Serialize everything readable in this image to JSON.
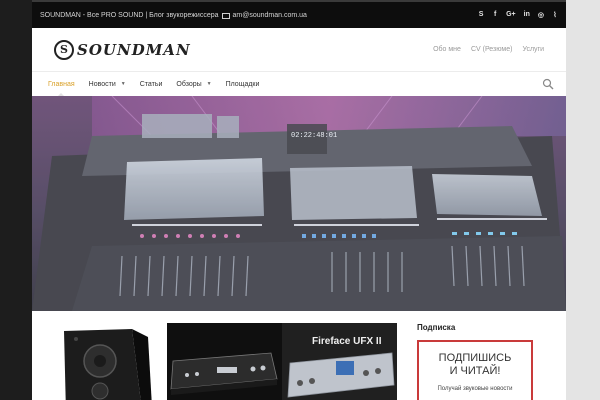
{
  "topbar": {
    "tagline": "SOUNDMAN - Все PRO SOUND | Блог звукорежиссера",
    "email": "am@soundman.com.ua",
    "social_icons": [
      {
        "name": "skype-icon",
        "glyph": "S"
      },
      {
        "name": "facebook-icon",
        "glyph": "f"
      },
      {
        "name": "google-plus-icon",
        "glyph": "G+"
      },
      {
        "name": "linkedin-icon",
        "glyph": "in"
      },
      {
        "name": "instagram-icon",
        "glyph": "◎"
      },
      {
        "name": "rss-icon",
        "glyph": "⌇"
      }
    ]
  },
  "header": {
    "logo_text": "SOUNDMAN",
    "top_links": [
      "Обо мне",
      "CV (Резюме)",
      "Услуги"
    ]
  },
  "nav": {
    "items": [
      {
        "label": "Главная",
        "active": true,
        "dropdown": false
      },
      {
        "label": "Новости",
        "active": false,
        "dropdown": true
      },
      {
        "label": "Статьи",
        "active": false,
        "dropdown": false
      },
      {
        "label": "Обзоры",
        "active": false,
        "dropdown": true
      },
      {
        "label": "Площадки",
        "active": false,
        "dropdown": false
      }
    ]
  },
  "hero": {
    "timecode": "02:22:48:01"
  },
  "products": {
    "tile_3_label": "Fireface UFX II"
  },
  "sidebar": {
    "title": "Подписка",
    "subscribe_big_line1": "ПОДПИШИСЬ",
    "subscribe_big_line2": "И ЧИТАЙ!",
    "subscribe_small": "Получай звуковые новости"
  },
  "colors": {
    "accent": "#d9a12a",
    "subscribe_border": "#c93a3a",
    "topbar_bg": "#0d0d0d"
  }
}
